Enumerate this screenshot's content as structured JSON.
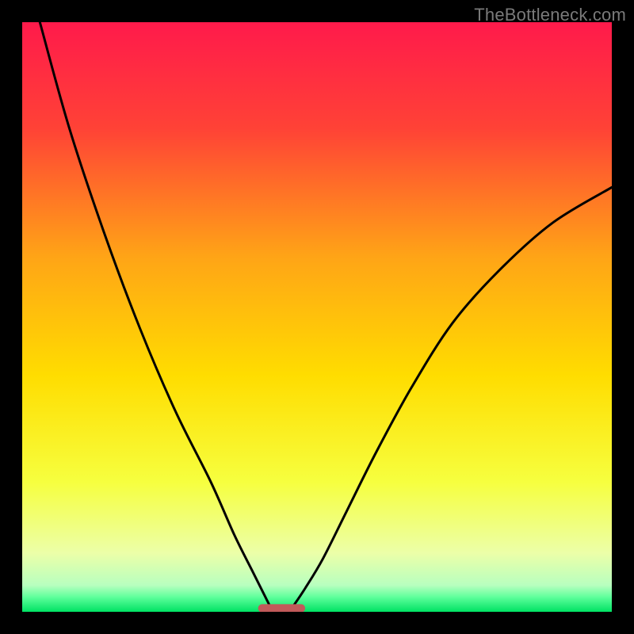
{
  "watermark": "TheBottleneck.com",
  "chart_data": {
    "type": "line",
    "title": "",
    "xlabel": "",
    "ylabel": "",
    "xlim": [
      0,
      100
    ],
    "ylim": [
      0,
      100
    ],
    "grid": false,
    "legend": false,
    "background_gradient_stops": [
      {
        "offset": 0.0,
        "color": "#ff1a4b"
      },
      {
        "offset": 0.18,
        "color": "#ff4236"
      },
      {
        "offset": 0.4,
        "color": "#ffa516"
      },
      {
        "offset": 0.6,
        "color": "#ffdd00"
      },
      {
        "offset": 0.78,
        "color": "#f6ff3f"
      },
      {
        "offset": 0.9,
        "color": "#ecffa8"
      },
      {
        "offset": 0.955,
        "color": "#b8ffbf"
      },
      {
        "offset": 0.975,
        "color": "#5eff9b"
      },
      {
        "offset": 1.0,
        "color": "#00e263"
      }
    ],
    "series": [
      {
        "name": "left-curve",
        "color": "#000000",
        "x": [
          3,
          8,
          14,
          20,
          26,
          32,
          36,
          39,
          41,
          42
        ],
        "y": [
          100,
          82,
          64,
          48,
          34,
          22,
          13,
          7,
          3,
          1
        ]
      },
      {
        "name": "right-curve",
        "color": "#000000",
        "x": [
          46,
          48,
          51,
          55,
          60,
          66,
          73,
          81,
          90,
          100
        ],
        "y": [
          1,
          4,
          9,
          17,
          27,
          38,
          49,
          58,
          66,
          72
        ]
      }
    ],
    "marker": {
      "name": "bottleneck-marker",
      "shape": "rounded-bar",
      "color": "#c15a5a",
      "x_center": 44,
      "width": 8,
      "y": 0.6,
      "height": 1.4
    }
  }
}
